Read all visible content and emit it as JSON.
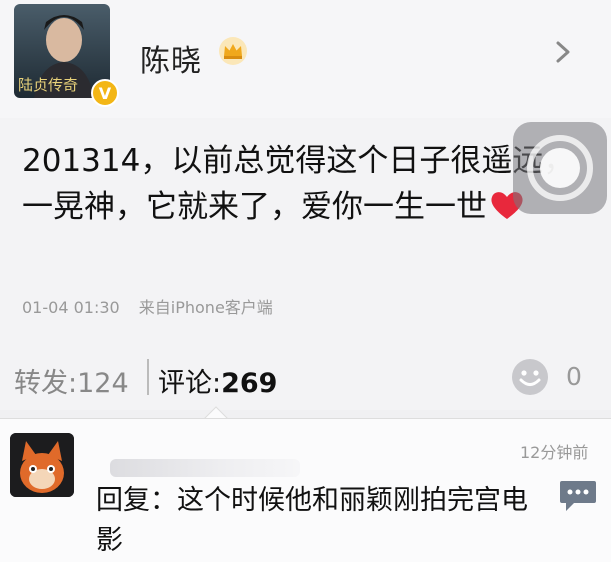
{
  "post": {
    "author": {
      "name": "陈晓",
      "avatar_caption": "陆贞传奇",
      "verified_badge": "V",
      "icons": {
        "crown": "crown-icon",
        "chevron": "chevron-right-icon"
      }
    },
    "text": "201314，以前总觉得这个日子很遥远，一晃神，它就来了，爱你一生一世",
    "emoji": "heart-icon",
    "time": "01-04 01:30",
    "source": "来自iPhone客户端",
    "actions": {
      "repost_label": "转发:",
      "repost_count": "124",
      "comment_label": "评论:",
      "comment_count": "269",
      "like_count": "0",
      "like_icon": "smiley-icon"
    }
  },
  "comment": {
    "time": "12分钟前",
    "text": "回复：这个时候他和丽颖刚拍完宫电影",
    "reply_icon": "speech-bubble-icon"
  },
  "colors": {
    "verified_badge": "#f3b616",
    "crown": "#f0a81c",
    "heart": "#e8283c",
    "reply_icon": "#6e7a8a"
  }
}
